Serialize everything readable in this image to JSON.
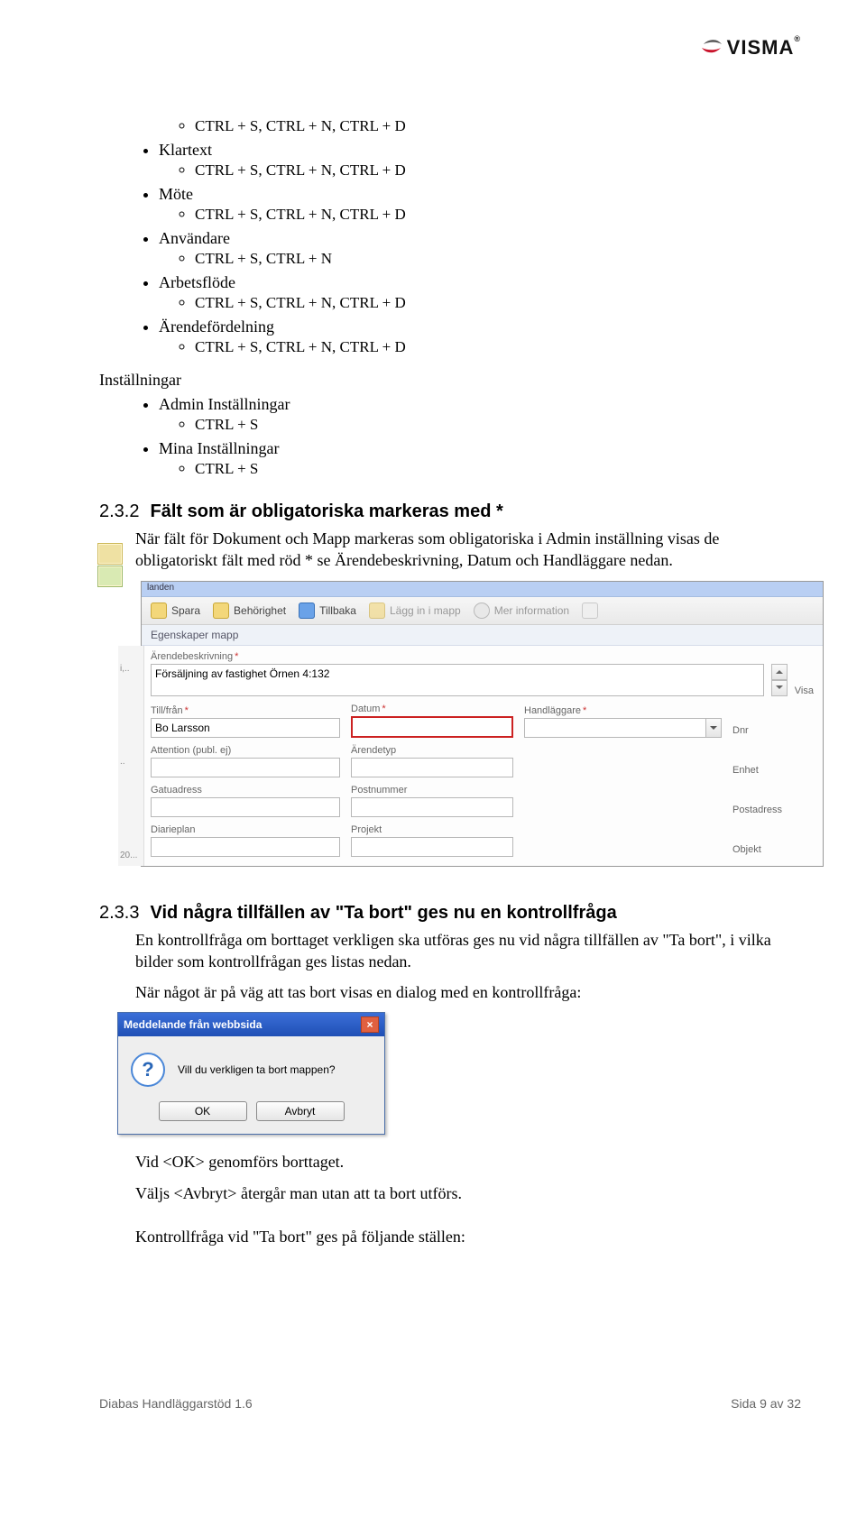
{
  "logo": {
    "text": "VISMA",
    "reg": "®"
  },
  "tree1": {
    "pre_item": "CTRL + S, CTRL + N, CTRL + D",
    "items": [
      {
        "label": "Klartext",
        "shortcut": "CTRL + S, CTRL + N, CTRL + D"
      },
      {
        "label": "Möte",
        "shortcut": "CTRL + S, CTRL + N, CTRL + D"
      },
      {
        "label": "Användare",
        "shortcut": "CTRL + S, CTRL + N"
      },
      {
        "label": "Arbetsflöde",
        "shortcut": "CTRL + S, CTRL + N, CTRL + D"
      },
      {
        "label": "Ärendefördelning",
        "shortcut": "CTRL + S, CTRL + N, CTRL + D"
      }
    ]
  },
  "section_installningar": {
    "heading": "Inställningar",
    "items": [
      {
        "label": "Admin Inställningar",
        "shortcut": "CTRL + S"
      },
      {
        "label": "Mina Inställningar",
        "shortcut": "CTRL + S"
      }
    ]
  },
  "sec232": {
    "num": "2.3.2",
    "title": "Fält som är obligatoriska markeras med *",
    "para": "När fält för Dokument och Mapp markeras som obligatoriska i Admin inställning  visas de obligatoriskt fält  med röd * se Ärendebeskrivning, Datum och Handläggare nedan."
  },
  "shot1": {
    "topstrip": "landen",
    "toolbar": {
      "save": "Spara",
      "permission": "Behörighet",
      "back": "Tillbaka",
      "putin": "Lägg in i mapp",
      "more": "Mer information"
    },
    "panel_title": "Egenskaper mapp",
    "fields": {
      "arendebeskrivning": {
        "label": "Ärendebeskrivning",
        "value": "Försäljning av fastighet Örnen 4:132"
      },
      "tillfran": {
        "label": "Till/från",
        "value": "Bo Larsson"
      },
      "datum": {
        "label": "Datum",
        "value": ""
      },
      "handlaggare": {
        "label": "Handläggare",
        "value": ""
      },
      "dnr": {
        "label": "Dnr"
      },
      "attention": {
        "label": "Attention (publ. ej)",
        "value": ""
      },
      "arendetyp": {
        "label": "Ärendetyp",
        "value": ""
      },
      "enhet": {
        "label": "Enhet"
      },
      "gatuadress": {
        "label": "Gatuadress",
        "value": ""
      },
      "postnummer": {
        "label": "Postnummer",
        "value": ""
      },
      "postadress": {
        "label": "Postadress"
      },
      "diarieplan": {
        "label": "Diarieplan",
        "value": ""
      },
      "projekt": {
        "label": "Projekt",
        "value": ""
      },
      "objekt": {
        "label": "Objekt"
      }
    },
    "right_label": "Visa",
    "leftside": {
      "top": "i,..",
      "mid": "..",
      "bottom": "20..."
    }
  },
  "sec233": {
    "num": "2.3.3",
    "title": "Vid några tillfällen av \"Ta bort\" ges nu en kontrollfråga",
    "para1": "En kontrollfråga om borttaget verkligen ska utföras ges nu vid några tillfällen av \"Ta bort\", i vilka bilder som kontrollfrågan ges listas nedan.",
    "para2": "När något är på väg att tas bort visas en dialog med en kontrollfråga:"
  },
  "shot2": {
    "title": "Meddelande från webbsida",
    "question": "Vill du verkligen ta bort mappen?",
    "ok": "OK",
    "cancel": "Avbryt"
  },
  "after_dialog": {
    "line1": "Vid <OK> genomförs borttaget.",
    "line2": "Väljs  <Avbryt> återgår man utan att ta bort utförs.",
    "line3": "Kontrollfråga vid \"Ta bort\" ges på följande ställen:"
  },
  "footer": {
    "left": "Diabas Handläggarstöd 1.6",
    "right": "Sida 9 av 32"
  }
}
